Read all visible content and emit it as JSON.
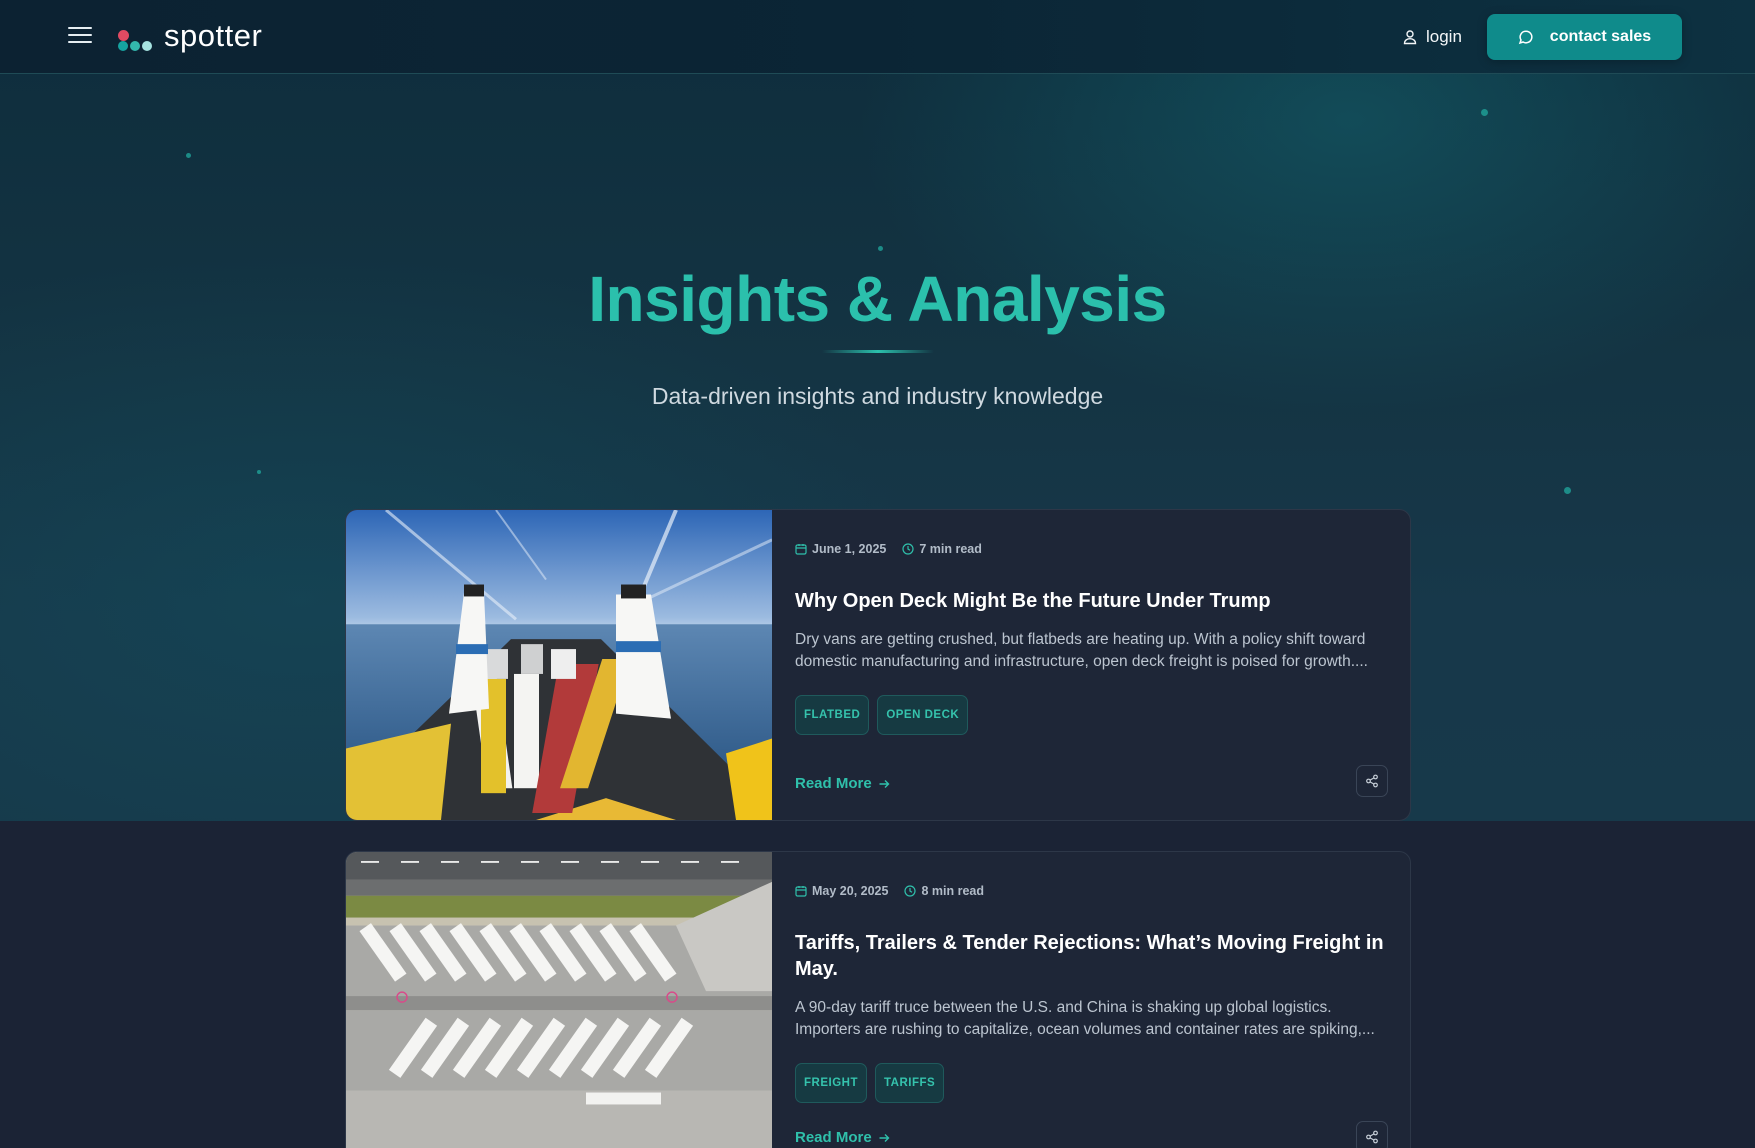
{
  "brand": {
    "name": "spotter",
    "accent": "#0f8b8b",
    "title_color": "#2bc0ac"
  },
  "header": {
    "menu_icon": "hamburger-menu-icon",
    "login_label": "login",
    "cta_label": "contact sales"
  },
  "hero": {
    "title": "Insights & Analysis",
    "subtitle": "Data-driven insights and industry knowledge"
  },
  "posts": [
    {
      "date": "June 1, 2025",
      "read_time": "7 min read",
      "title": "Why Open Deck Might Be the Future Under Trump",
      "excerpt": "Dry vans are getting crushed, but flatbeds are heating up. With a policy shift toward domestic manufacturing and infrastructure, open deck freight is poised for growth....",
      "tags": [
        "FLATBED",
        "OPEN DECK"
      ],
      "read_more": "Read More",
      "image": "ferry-deck-with-trailers-photo"
    },
    {
      "date": "May 20, 2025",
      "read_time": "8 min read",
      "title": "Tariffs, Trailers & Tender Rejections: What’s Moving Freight in May.",
      "excerpt": "A 90-day tariff truce between the U.S. and China is shaking up global logistics. Importers are rushing to capitalize, ocean volumes and container rates are spiking,...",
      "tags": [
        "FREIGHT",
        "TARIFFS"
      ],
      "read_more": "Read More",
      "image": "aerial-truck-parking-lot-photo"
    }
  ]
}
